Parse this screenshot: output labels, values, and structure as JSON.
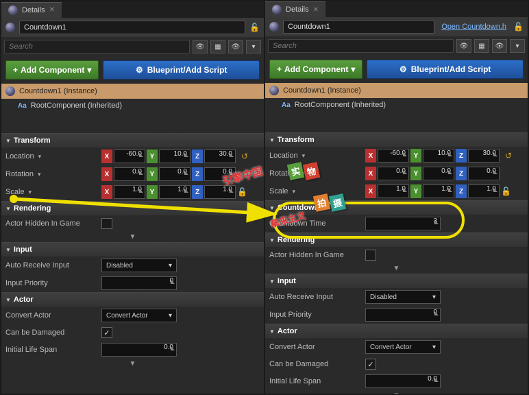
{
  "tab_title": "Details",
  "object_name": "Countdown1",
  "open_link": "Open Countdown.h",
  "search_placeholder": "Search",
  "btn_add": "Add Component",
  "btn_blueprint": "Blueprint/Add Script",
  "instance": "Countdown1 (Instance)",
  "root_comp": "RootComponent (Inherited)",
  "sections": {
    "transform": "Transform",
    "rendering": "Rendering",
    "input": "Input",
    "actor": "Actor",
    "countdown": "Countdown"
  },
  "props": {
    "location": "Location",
    "rotation": "Rotation",
    "scale": "Scale",
    "hidden": "Actor Hidden In Game",
    "auto_receive": "Auto Receive Input",
    "input_priority": "Input Priority",
    "convert": "Convert Actor",
    "damaged": "Can be Damaged",
    "lifespan": "Initial Life Span",
    "countdown_time": "Countdown Time"
  },
  "values": {
    "loc_x": "-60.0",
    "loc_y": "10.0",
    "loc_z": "30.0",
    "rot_x": "0.0",
    "rot_y": "0.0",
    "rot_z": "0.0",
    "scl_x": "1.0",
    "scl_y": "1.0",
    "scl_z": "1.0",
    "disabled": "Disabled",
    "zero": "0",
    "zero_f": "0.0",
    "three": "3",
    "convert_actor": "Convert Actor"
  },
  "chart_data": null
}
